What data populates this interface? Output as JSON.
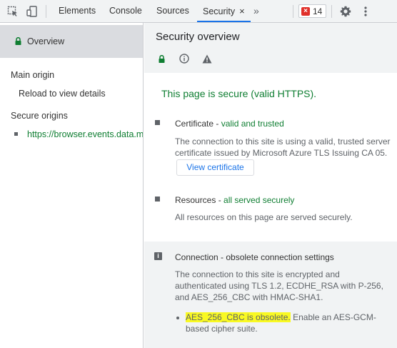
{
  "toolbar": {
    "tabs": [
      {
        "label": "Elements"
      },
      {
        "label": "Console"
      },
      {
        "label": "Sources"
      },
      {
        "label": "Security",
        "active": true
      }
    ],
    "tab_close_glyph": "×",
    "more_tabs_glyph": "»",
    "issues_count": "14",
    "icons": [
      "inspect-element-icon",
      "device-toolbar-icon",
      "error-icon",
      "gear-icon",
      "more-options-icon"
    ]
  },
  "sidebar": {
    "overview_label": "Overview",
    "main_origin_heading": "Main origin",
    "main_origin_item": "Reload to view details",
    "secure_origins_heading": "Secure origins",
    "secure_origins": [
      "https://browser.events.data.microsoft.com"
    ]
  },
  "main": {
    "title": "Security overview",
    "summary": "This page is secure (valid HTTPS).",
    "certificate": {
      "title_prefix": "Certificate - ",
      "status": "valid and trusted",
      "description": "The connection to this site is using a valid, trusted server certificate issued by Microsoft Azure TLS Issuing CA 05.",
      "button_label": "View certificate"
    },
    "resources": {
      "title_prefix": "Resources - ",
      "status": "all served securely",
      "description": "All resources on this page are served securely."
    },
    "connection": {
      "title": "Connection - obsolete connection settings",
      "description": "The connection to this site is encrypted and authenticated using TLS 1.2, ECDHE_RSA with P-256, and AES_256_CBC with HMAC-SHA1.",
      "note_highlight": "AES_256_CBC is obsolete.",
      "note_rest": " Enable an AES-GCM-based cipher suite."
    }
  },
  "colors": {
    "secure_green": "#0f7e32",
    "link_blue": "#1a73e8",
    "error_red": "#e0302a",
    "highlight_yellow": "#f9f923",
    "panel_gray": "#f1f3f4"
  }
}
